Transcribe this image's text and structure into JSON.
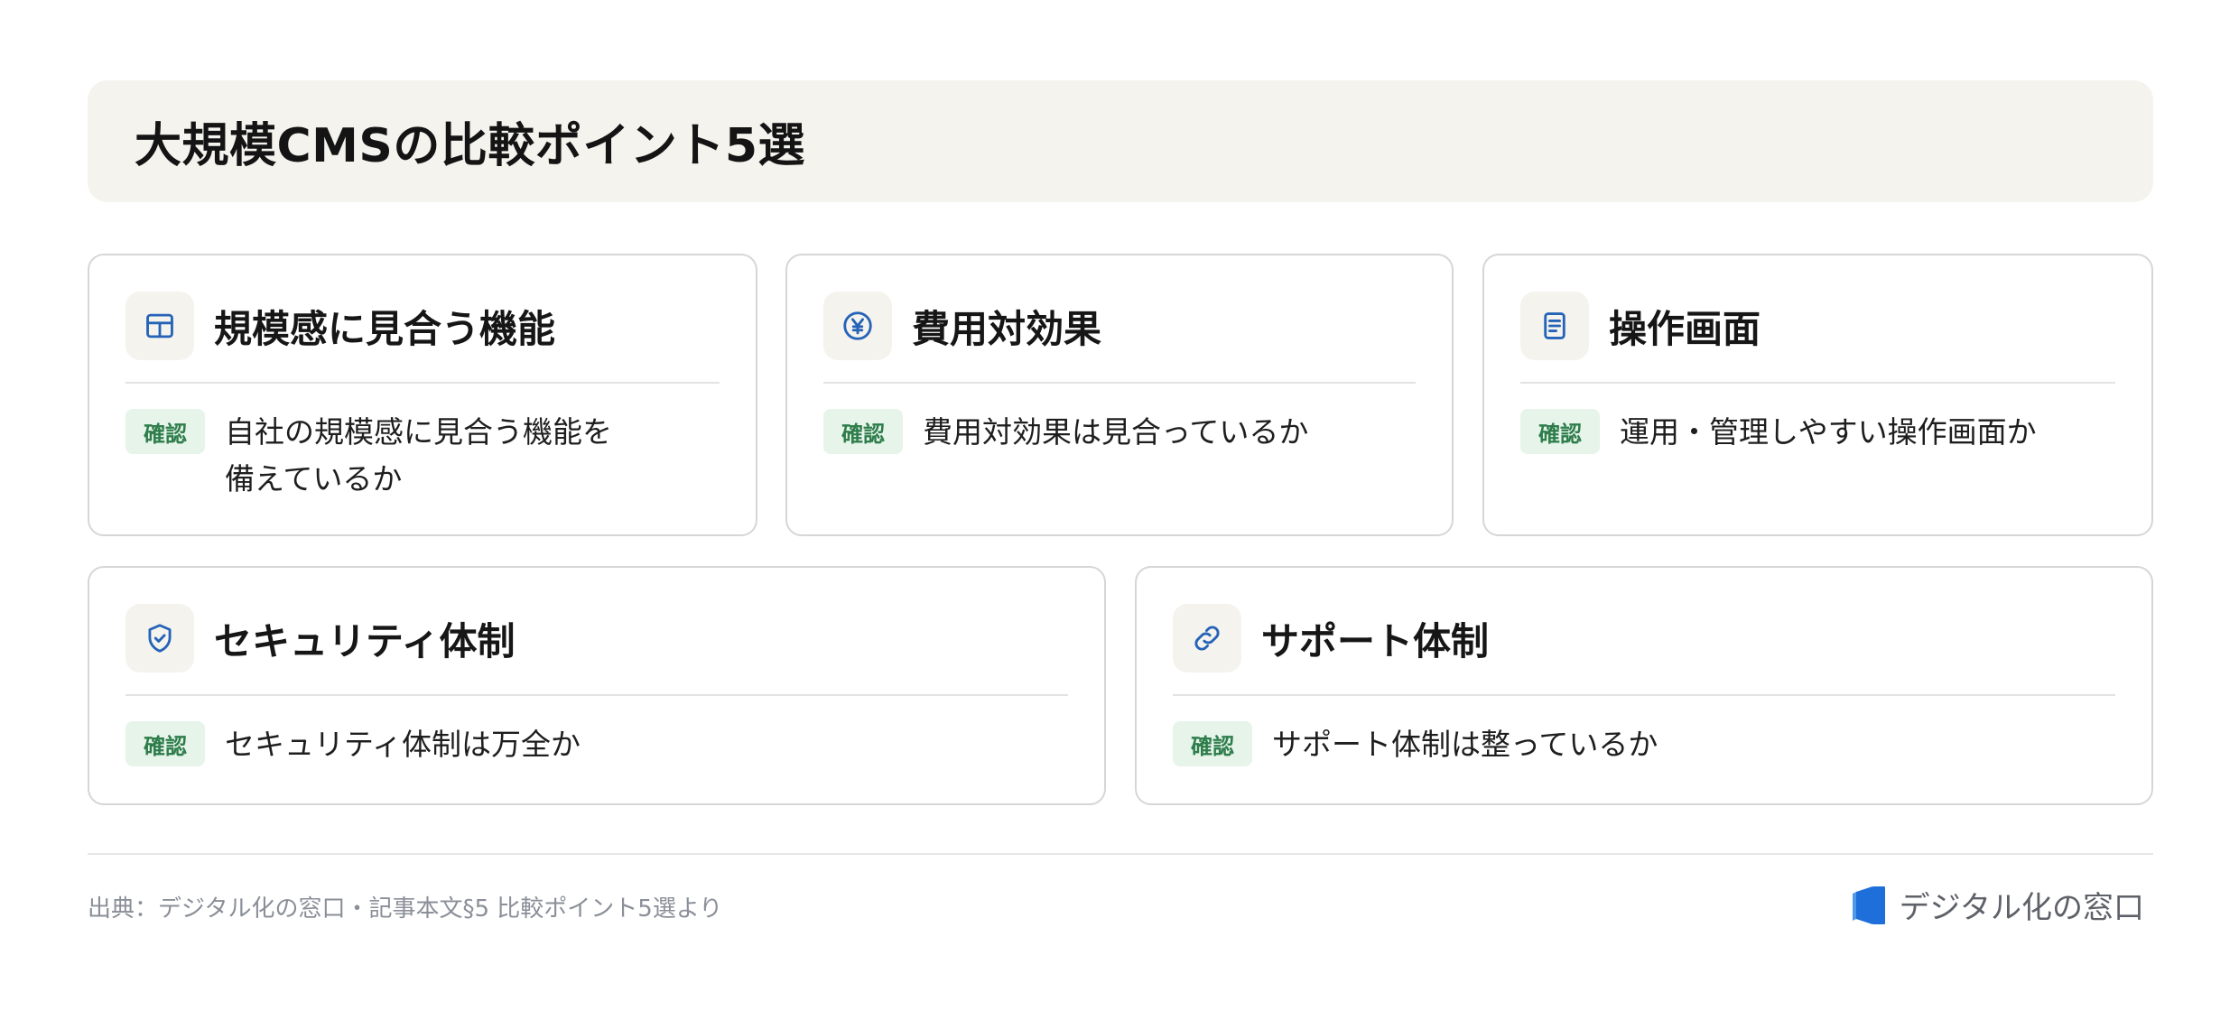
{
  "title": "大規模CMSの比較ポイント5選",
  "colors": {
    "banner_bg": "#f5f3ee",
    "icon_accent": "#2563b8",
    "badge_bg": "#e6f4ea",
    "badge_text": "#2e7d4b",
    "brand_accent": "#1e6fd9"
  },
  "cards": [
    {
      "icon": "grid-icon",
      "title": "規模感に見合う機能",
      "badge": "確認",
      "text": "自社の規模感に見合う機能を\n備えているか"
    },
    {
      "icon": "yen-icon",
      "title": "費用対効果",
      "badge": "確認",
      "text": "費用対効果は見合っているか"
    },
    {
      "icon": "document-icon",
      "title": "操作画面",
      "badge": "確認",
      "text": "運用・管理しやすい操作画面か"
    },
    {
      "icon": "shield-icon",
      "title": "セキュリティ体制",
      "badge": "確認",
      "text": "セキュリティ体制は万全か"
    },
    {
      "icon": "link-icon",
      "title": "サポート体制",
      "badge": "確認",
      "text": "サポート体制は整っているか"
    }
  ],
  "footer": {
    "source": "出典：デジタル化の窓口・記事本文§5 比較ポイント5選より",
    "brand": "デジタル化の窓口"
  }
}
